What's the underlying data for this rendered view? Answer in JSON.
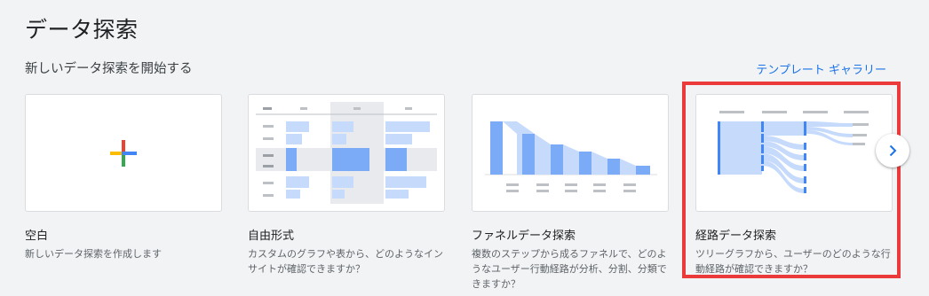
{
  "header": {
    "title": "データ探索",
    "section_title": "新しいデータ探索を開始する",
    "gallery_link": "テンプレート ギャラリー"
  },
  "cards": [
    {
      "title": "空白",
      "description": "新しいデータ探索を作成します",
      "thumbnail": "blank-plus"
    },
    {
      "title": "自由形式",
      "description": "カスタムのグラフや表から、どのようなインサイトが確認できますか？",
      "thumbnail": "freeform-table"
    },
    {
      "title": "ファネルデータ探索",
      "description": "複数のステップから成るファネルで、どのようなユーザー行動経路が分析、分割、分類できますか？",
      "thumbnail": "funnel-chart"
    },
    {
      "title": "経路データ探索",
      "description": "ツリーグラフから、ユーザーのどのような行動経路が確認できますか？",
      "thumbnail": "path-tree",
      "highlighted": true
    }
  ],
  "carousel": {
    "next_icon": "chevron-right-icon"
  },
  "colors": {
    "accent": "#1a73e8",
    "highlight": "#ea3a3a",
    "chart_blue": "#7baaf7",
    "chart_light_blue": "#c6dafc"
  }
}
